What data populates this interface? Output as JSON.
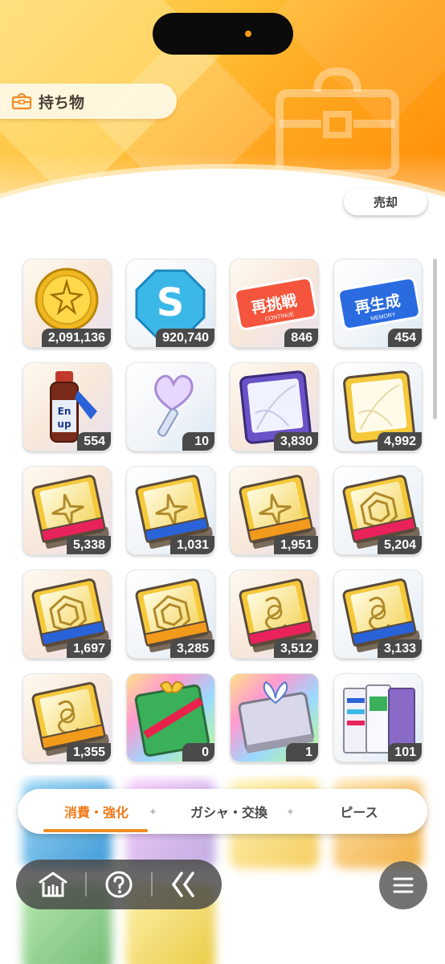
{
  "header": {
    "title": "持ち物",
    "sell_label": "売却"
  },
  "items": [
    {
      "name": "gold-coin",
      "count": "2,091,136"
    },
    {
      "name": "s-coin",
      "count": "920,740"
    },
    {
      "name": "retry-ticket",
      "count": "846",
      "ticket_text": "再挑戦",
      "ticket_sub": "CONTINUE"
    },
    {
      "name": "regen-ticket",
      "count": "454",
      "ticket_text": "再生成",
      "ticket_sub": "MEMORY"
    },
    {
      "name": "energy-drink",
      "count": "554",
      "drink_text": "En up"
    },
    {
      "name": "heart-key",
      "count": "10"
    },
    {
      "name": "purple-book",
      "count": "3,830"
    },
    {
      "name": "yellow-book",
      "count": "4,992"
    },
    {
      "name": "sparkle-book-pink",
      "count": "5,338"
    },
    {
      "name": "sparkle-book-blue",
      "count": "1,031"
    },
    {
      "name": "sparkle-book-orange",
      "count": "1,951"
    },
    {
      "name": "hex-book-pink",
      "count": "5,204"
    },
    {
      "name": "hex-book-blue",
      "count": "1,697"
    },
    {
      "name": "hex-book-orange",
      "count": "3,285"
    },
    {
      "name": "loop-book-pink",
      "count": "3,512"
    },
    {
      "name": "loop-book-blue",
      "count": "3,133"
    },
    {
      "name": "loop-book-orange",
      "count": "1,355"
    },
    {
      "name": "gift-book",
      "count": "0"
    },
    {
      "name": "ribbon-book",
      "count": "1"
    },
    {
      "name": "book-set",
      "count": "101"
    }
  ],
  "tabs": [
    {
      "label": "消費・強化",
      "active": true
    },
    {
      "label": "ガシャ・交換",
      "active": false
    },
    {
      "label": "ピース",
      "active": false
    }
  ],
  "nav": {
    "home_icon": "home-icon",
    "help_icon": "help-icon",
    "back_icon": "back-icon",
    "menu_icon": "menu-icon"
  },
  "colors": {
    "accent": "#f07a1a",
    "header_orange": "#ff8a00",
    "count_badge": "#4a4a4a"
  }
}
